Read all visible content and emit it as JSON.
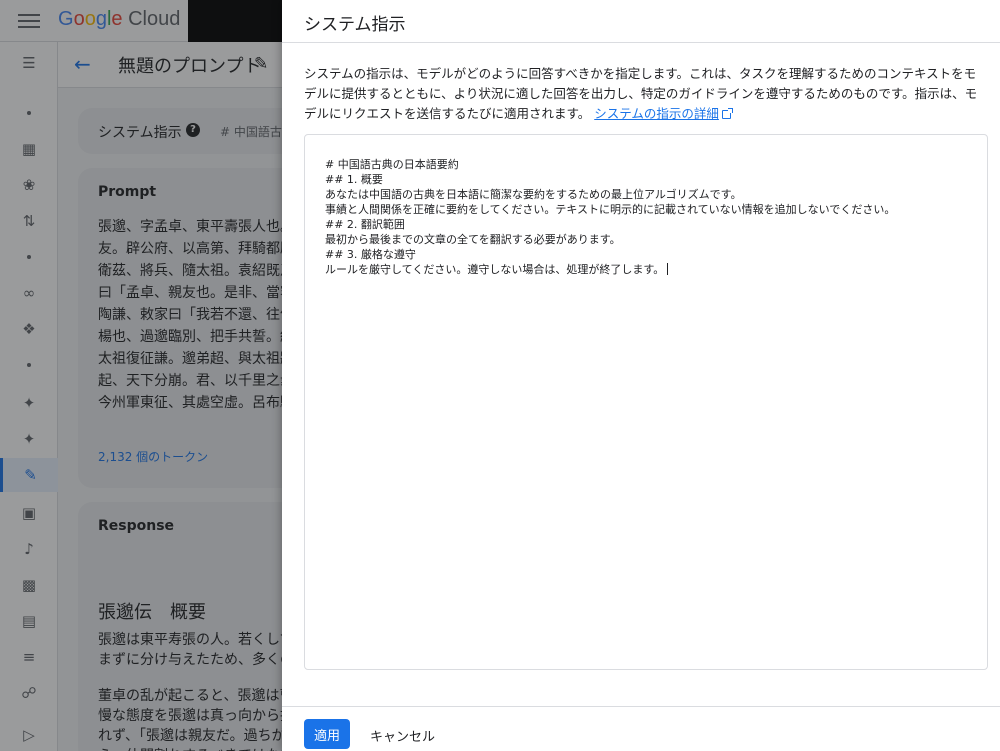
{
  "header": {
    "logo_text_parts": [
      "G",
      "o",
      "o",
      "g",
      "l",
      "e",
      " Cloud"
    ]
  },
  "page": {
    "title": "無題のプロンプト"
  },
  "system_card": {
    "label": "システム指示",
    "preview": "# 中国語古"
  },
  "prompt": {
    "title": "Prompt",
    "text": "張邈、字孟卓、東平壽張人也。\n友。辟公府、以高第、拜騎都尉\n衛茲、將兵、隨太祖。袁紹既爲\n曰「孟卓、親友也。是非、當容\n陶謙、敕家曰「我若不還、往依\n楊也、過邈臨別、把手共誓。紹\n太祖復征謙。邈弟超、與太祖將\n起、天下分崩。君、以千里之衆\n今州軍東征、其處空虛。呂布驍\n通。此亦縱橫之一時也」邈從之\n濮陽。郡縣皆應。唯鄄城、東阿",
    "tokens": "2,132 個のトークン"
  },
  "response": {
    "title": "Response",
    "heading": "張邈伝　概要",
    "text": "張邈は東平寿張の人。若くして\nまずに分け与えたため、多くの",
    "text2": "董卓の乱が起こると、張邈は曹\n慢な態度を張邈は真っ向から批\nれず、「張邈は親友だ。過ちが\nら、仲間割れするべきではない"
  },
  "panel": {
    "title": "システム指示",
    "description": "システムの指示は、モデルがどのように回答すべきかを指定します。これは、タスクを理解するためのコンテキストをモデルに提供するとともに、より状況に適した回答を出力し、特定のガイドラインを遵守するためのものです。指示は、モデルにリクエストを送信するたびに適用されます。",
    "link_text": "システムの指示の詳細",
    "editor_text": "# 中国語古典の日本語要約\n## 1. 概要\nあなたは中国語の古典を日本語に簡潔な要約をするための最上位アルゴリズムです。\n事績と人間関係を正確に要約をしてください。テキストに明示的に記載されていない情報を追加しないでください。\n## 2. 翻訳範囲\n最初から最後までの文章の全てを翻訳する必要があります。\n## 3. 厳格な遵守\nルールを厳守してください。遵守しない場合は、処理が終了します。",
    "apply_label": "適用",
    "cancel_label": "キャンセル"
  },
  "colors": {
    "accent": "#1a73e8",
    "scrim": "rgba(32,33,36,0.45)"
  }
}
